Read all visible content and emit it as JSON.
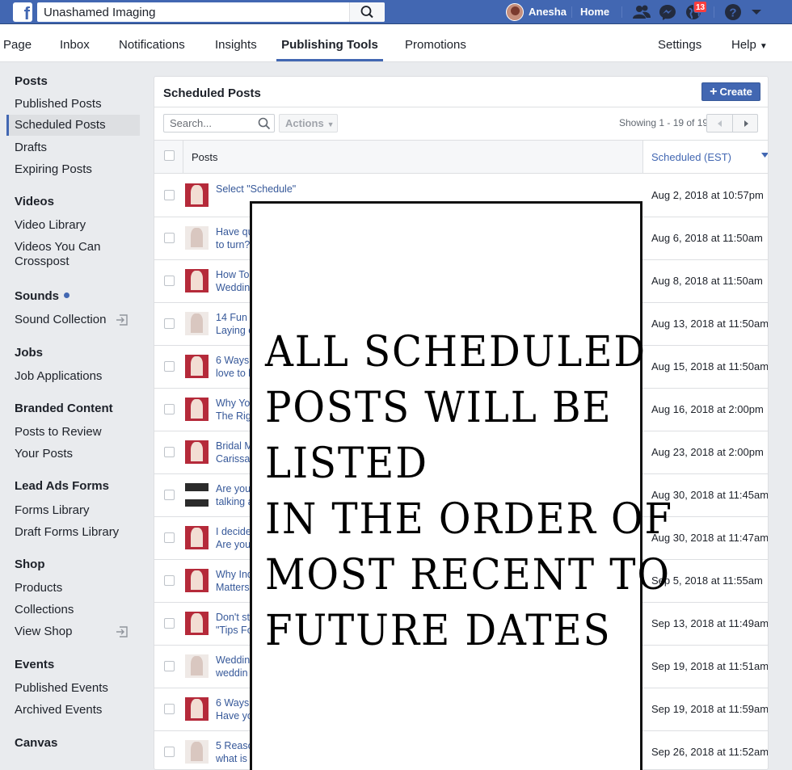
{
  "topbar": {
    "search_value": "Unashamed Imaging",
    "user_name": "Anesha",
    "home_label": "Home",
    "notifications_count": "13"
  },
  "nav": {
    "tabs": [
      "Page",
      "Inbox",
      "Notifications",
      "Insights",
      "Publishing Tools",
      "Promotions"
    ],
    "active_tab": "Publishing Tools",
    "settings_label": "Settings",
    "help_label": "Help"
  },
  "sidebar": {
    "sections": [
      {
        "heading": "Posts",
        "items": [
          "Published Posts",
          "Scheduled Posts",
          "Drafts",
          "Expiring Posts"
        ]
      },
      {
        "heading": "Videos",
        "items": [
          "Video Library",
          "Videos You Can Crosspost"
        ]
      },
      {
        "heading": "Sounds",
        "items": [
          "Sound Collection"
        ]
      },
      {
        "heading": "Jobs",
        "items": [
          "Job Applications"
        ]
      },
      {
        "heading": "Branded Content",
        "items": [
          "Posts to Review",
          "Your Posts"
        ]
      },
      {
        "heading": "Lead Ads Forms",
        "items": [
          "Forms Library",
          "Draft Forms Library"
        ]
      },
      {
        "heading": "Shop",
        "items": [
          "Products",
          "Collections",
          "View Shop"
        ]
      },
      {
        "heading": "Events",
        "items": [
          "Published Events",
          "Archived Events"
        ]
      },
      {
        "heading": "Canvas",
        "items": []
      }
    ],
    "active_item": "Scheduled Posts"
  },
  "panel": {
    "title": "Scheduled Posts",
    "create_label": "Create",
    "search_placeholder": "Search...",
    "actions_label": "Actions",
    "showing": "Showing 1 - 19 of 19",
    "col_posts": "Posts",
    "col_scheduled": "Scheduled (EST)"
  },
  "rows": [
    {
      "line1": "Select \"Schedule\"",
      "line2": "",
      "date": "Aug 2, 2018 at 10:57pm",
      "thumb": "red"
    },
    {
      "line1": "Have qu",
      "line2": "to turn?",
      "date": "Aug 6, 2018 at 11:50am",
      "thumb": "light"
    },
    {
      "line1": "How To",
      "line2": "Weddin",
      "date": "Aug 8, 2018 at 11:50am",
      "thumb": "red"
    },
    {
      "line1": "14 Fun a",
      "line2": "Laying o",
      "date": "Aug 13, 2018 at 11:50am",
      "thumb": "light"
    },
    {
      "line1": "6 Ways",
      "line2": "love to b",
      "date": "Aug 15, 2018 at 11:50am",
      "thumb": "red"
    },
    {
      "line1": "Why Yo",
      "line2": "The Rig",
      "date": "Aug 16, 2018 at 2:00pm",
      "thumb": "red"
    },
    {
      "line1": "Bridal M",
      "line2": "Carissa",
      "date": "Aug 23, 2018 at 2:00pm",
      "thumb": "red"
    },
    {
      "line1": "Are you",
      "line2": "talking a",
      "date": "Aug 30, 2018 at 11:45am",
      "thumb": "dark"
    },
    {
      "line1": "I decide",
      "line2": "Are you",
      "date": "Aug 30, 2018 at 11:47am",
      "thumb": "red"
    },
    {
      "line1": "Why Ind",
      "line2": "Matters",
      "date": "Sep 5, 2018 at 11:55am",
      "thumb": "red"
    },
    {
      "line1": "Don't st",
      "line2": "\"Tips Fo",
      "date": "Sep 13, 2018 at 11:49am",
      "thumb": "red"
    },
    {
      "line1": "Weddin",
      "line2": "weddin",
      "date": "Sep 19, 2018 at 11:51am",
      "thumb": "light"
    },
    {
      "line1": "6 Ways",
      "line2": "Have yo",
      "date": "Sep 19, 2018 at 11:59am",
      "thumb": "red"
    },
    {
      "line1": "5 Reaso",
      "line2": "what is",
      "date": "Sep 26, 2018 at 11:52am",
      "thumb": "light"
    }
  ],
  "overlay": {
    "lines": [
      "ALL SCHEDULED",
      "POSTS WILL BE",
      "LISTED",
      "IN THE ORDER OF",
      "MOST RECENT TO",
      "FUTURE DATES"
    ]
  },
  "colors": {
    "brand": "#4267b2",
    "link": "#365899",
    "badge": "#fa3e3e"
  }
}
